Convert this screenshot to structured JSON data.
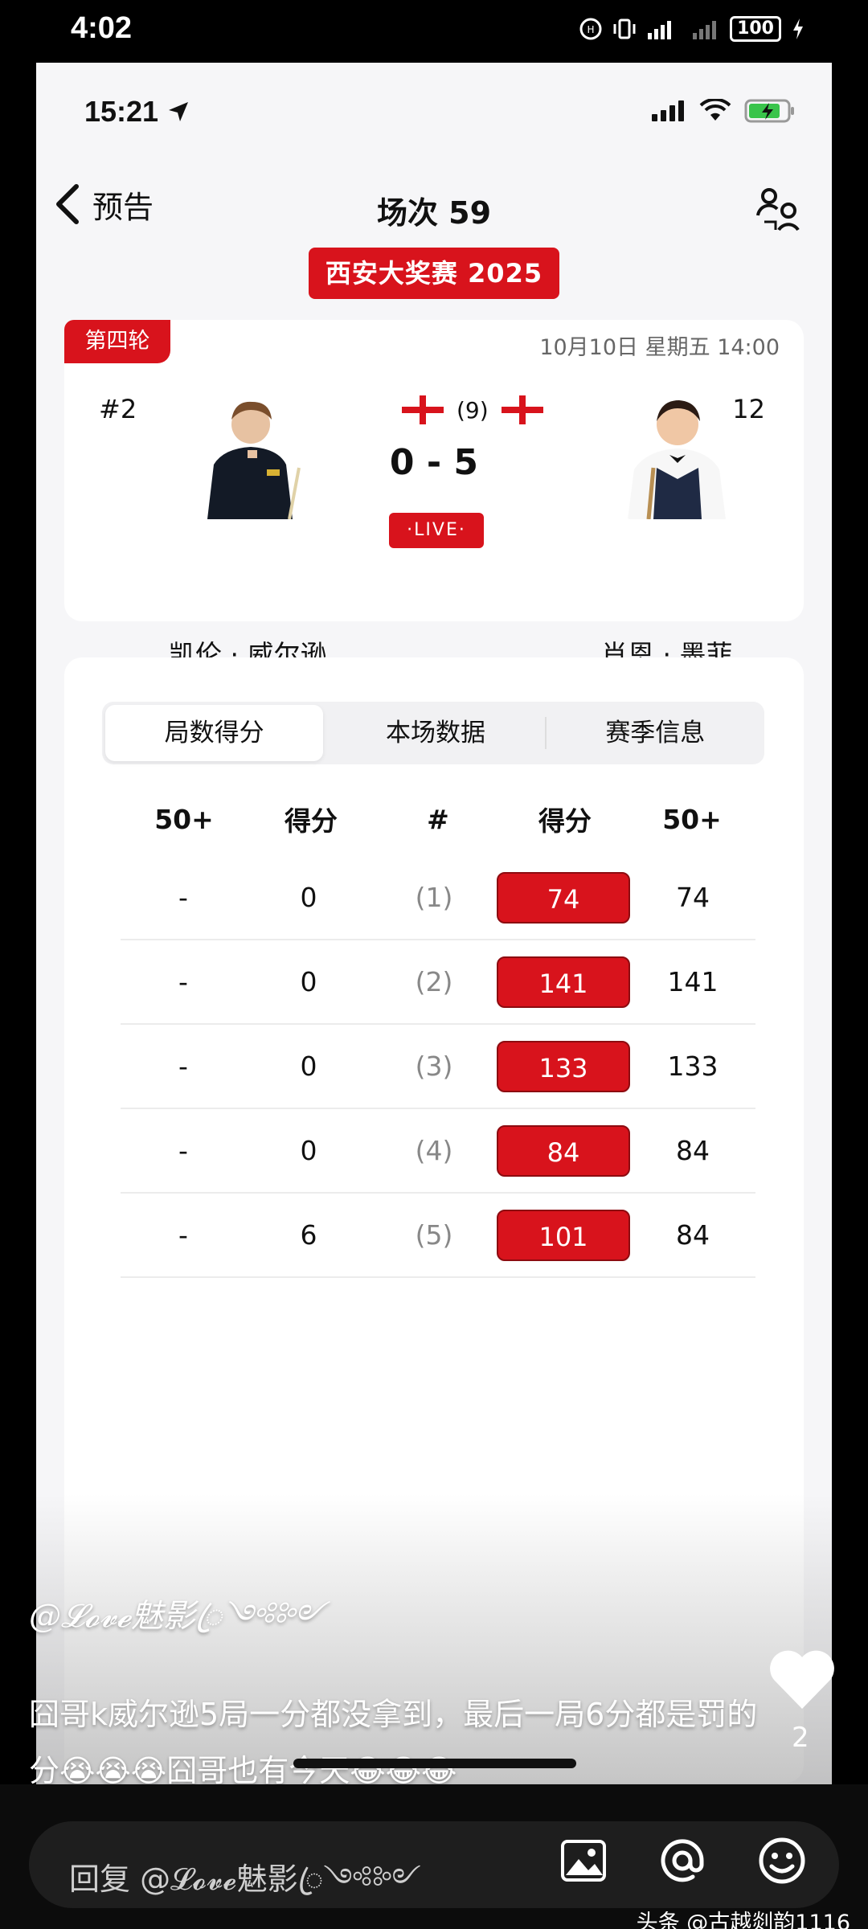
{
  "android_status": {
    "time": "4:02",
    "battery": "100"
  },
  "ios_status": {
    "time": "15:21"
  },
  "nav": {
    "back_label": "预告",
    "title": "场次 59"
  },
  "event": {
    "name": "西安大奖赛 2025"
  },
  "match": {
    "round": "第四轮",
    "datetime": "10月10日 星期五 14:00",
    "left_player": {
      "rank": "#2",
      "name": "凯伦 · 威尔逊"
    },
    "right_player": {
      "rank": "#12",
      "name": "肖恩 · 墨菲"
    },
    "best_of": "(9)",
    "score": "0 - 5",
    "live": "·LIVE·"
  },
  "tabs": [
    {
      "label": "局数得分",
      "active": true
    },
    {
      "label": "本场数据",
      "active": false
    },
    {
      "label": "赛季信息",
      "active": false
    }
  ],
  "table": {
    "headers": [
      "50+",
      "得分",
      "#",
      "得分",
      "50+"
    ],
    "rows": [
      {
        "left_50": "-",
        "left_score": "0",
        "frame": "(1)",
        "right_score": "74",
        "right_50": "74"
      },
      {
        "left_50": "-",
        "left_score": "0",
        "frame": "(2)",
        "right_score": "141",
        "right_50": "141"
      },
      {
        "left_50": "-",
        "left_score": "0",
        "frame": "(3)",
        "right_score": "133",
        "right_50": "133"
      },
      {
        "left_50": "-",
        "left_score": "0",
        "frame": "(4)",
        "right_score": "84",
        "right_50": "84"
      },
      {
        "left_50": "-",
        "left_score": "6",
        "frame": "(5)",
        "right_score": "101",
        "right_50": "84"
      }
    ]
  },
  "comment": {
    "user": "@𝓛𝓸𝓿𝓮魅影ꦿ༺༻",
    "text": "囧哥k威尔逊5局一分都没拿到，最后一局6分都是罚的分😭😭😭囧哥也有今天😂😂😂",
    "likes": "2"
  },
  "reply": {
    "placeholder": "回复 @𝓛𝓸𝓿𝓮魅影ꦿ༺༻"
  },
  "watermark": "头条 @古越剡韵1116",
  "colors": {
    "accent": "#d8131c"
  }
}
